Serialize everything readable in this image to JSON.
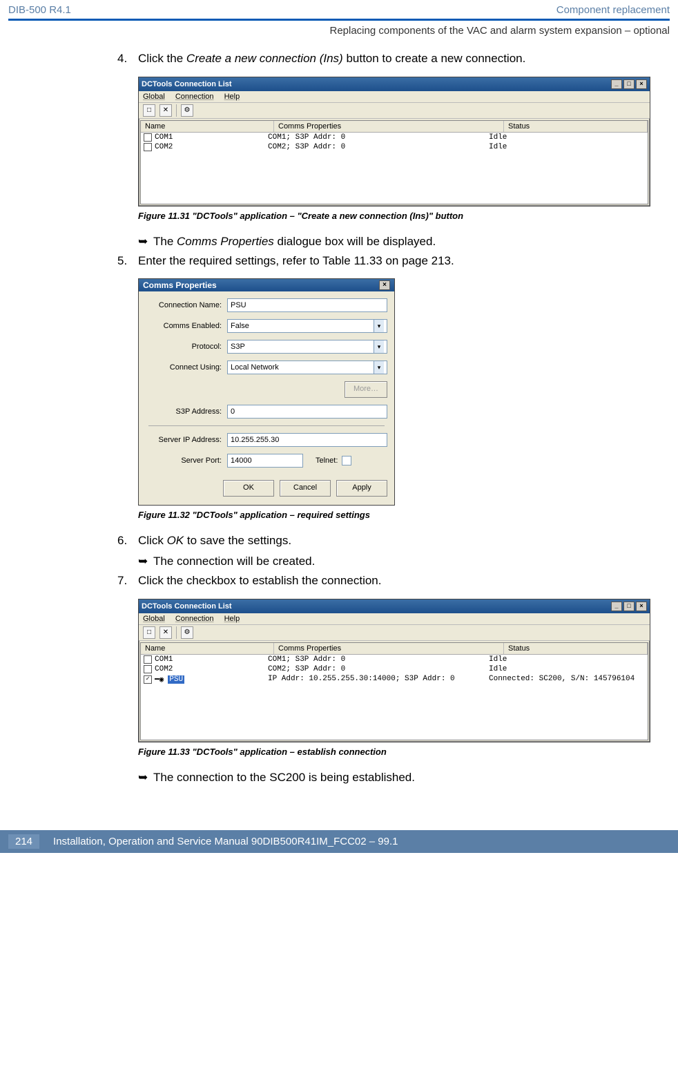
{
  "header": {
    "left": "DIB-500 R4.1",
    "right": "Component replacement",
    "sub": "Replacing components of the VAC and alarm system expansion – optional"
  },
  "steps": {
    "s4_pre": "Click the ",
    "s4_em": "Create a new connection (Ins)",
    "s4_post": " button to create a new connection.",
    "arrow1_pre": "The ",
    "arrow1_em": "Comms Properties",
    "arrow1_post": " dialogue box will be displayed.",
    "s5": "Enter the required settings, refer to Table 11.33 on page 213.",
    "s6_pre": "Click ",
    "s6_em": "OK",
    "s6_post": " to save the settings.",
    "arrow2": "The connection will be created.",
    "s7": "Click the checkbox to establish the connection.",
    "arrow3": "The connection to the SC200 is being established."
  },
  "captions": {
    "f31": "Figure 11.31 \"DCTools\" application – \"Create a new connection (Ins)\" button",
    "f32": "Figure 11.32 \"DCTools\" application – required settings",
    "f33": "Figure 11.33 \"DCTools\" application – establish connection"
  },
  "win": {
    "title": "DCTools Connection List",
    "menus": {
      "m1": "Global",
      "m2": "Connection",
      "m3": "Help"
    },
    "cols": {
      "name": "Name",
      "props": "Comms Properties",
      "status": "Status"
    },
    "rows1": [
      {
        "name": "COM1",
        "props": "COM1; S3P Addr: 0",
        "status": "Idle"
      },
      {
        "name": "COM2",
        "props": "COM2; S3P Addr: 0",
        "status": "Idle"
      }
    ],
    "rows2": [
      {
        "name": "COM1",
        "props": "COM1; S3P Addr: 0",
        "status": "Idle",
        "chk": false
      },
      {
        "name": "COM2",
        "props": "COM2; S3P Addr: 0",
        "status": "Idle",
        "chk": false
      },
      {
        "name": "PSU",
        "props": "IP Addr: 10.255.255.30:14000; S3P Addr: 0",
        "status": "Connected: SC200, S/N: 145796104",
        "chk": true,
        "sel": true
      }
    ]
  },
  "dlg": {
    "title": "Comms Properties",
    "labels": {
      "cname": "Connection Name:",
      "cen": "Comms Enabled:",
      "proto": "Protocol:",
      "cusing": "Connect Using:",
      "more": "More…",
      "s3p": "S3P Address:",
      "sip": "Server IP Address:",
      "sport": "Server Port:",
      "telnet": "Telnet:"
    },
    "values": {
      "cname": "PSU",
      "cen": "False",
      "proto": "S3P",
      "cusing": "Local Network",
      "s3p": "0",
      "sip": "10.255.255.30",
      "sport": "14000"
    },
    "btns": {
      "ok": "OK",
      "cancel": "Cancel",
      "apply": "Apply"
    }
  },
  "footer": {
    "page": "214",
    "text": "Installation, Operation and Service Manual 90DIB500R41IM_FCC02  –  99.1"
  }
}
